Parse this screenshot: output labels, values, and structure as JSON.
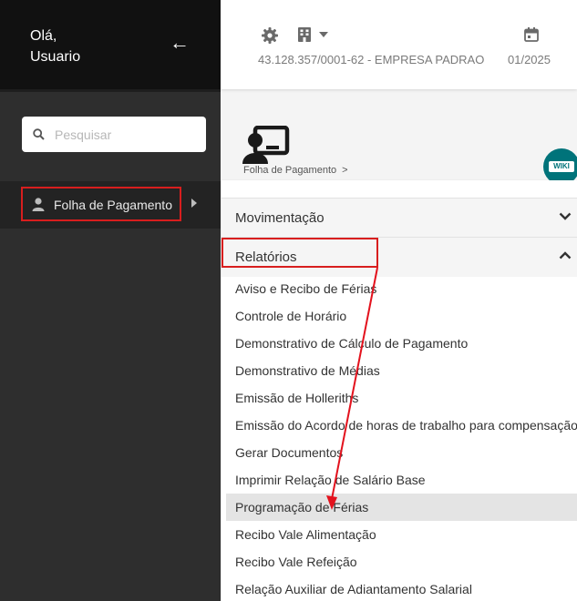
{
  "sidebar": {
    "greeting": "Olá,",
    "user_name": "Usuario",
    "search_placeholder": "Pesquisar",
    "active_item": "Folha de Pagamento"
  },
  "header": {
    "company": "43.128.357/0001-62 - EMPRESA PADRAO",
    "period": "01/2025"
  },
  "breadcrumb": {
    "module": "Folha de Pagamento",
    "separator": ">"
  },
  "wiki_label": "WIKI",
  "panel": {
    "sections": [
      {
        "title": "Movimentação",
        "expanded": false
      },
      {
        "title": "Relatórios",
        "expanded": true
      }
    ],
    "items": [
      "Aviso e Recibo de Férias",
      "Controle de Horário",
      "Demonstrativo de Cálculo de Pagamento",
      "Demonstrativo de Médias",
      "Emissão de Holleriths",
      "Emissão do Acordo de horas de trabalho para compensação",
      "Gerar Documentos",
      "Imprimir Relação de Salário Base",
      "Programação de Férias",
      "Recibo Vale Alimentação",
      "Recibo Vale Refeição",
      "Relação Auxiliar de Adiantamento Salarial"
    ],
    "selected_item": "Programação de Férias"
  },
  "colors": {
    "highlight": "#d81e1e",
    "sidebar_bg": "#2e2e2e",
    "sidebar_top": "#111111",
    "wiki_bg": "#00737a"
  }
}
